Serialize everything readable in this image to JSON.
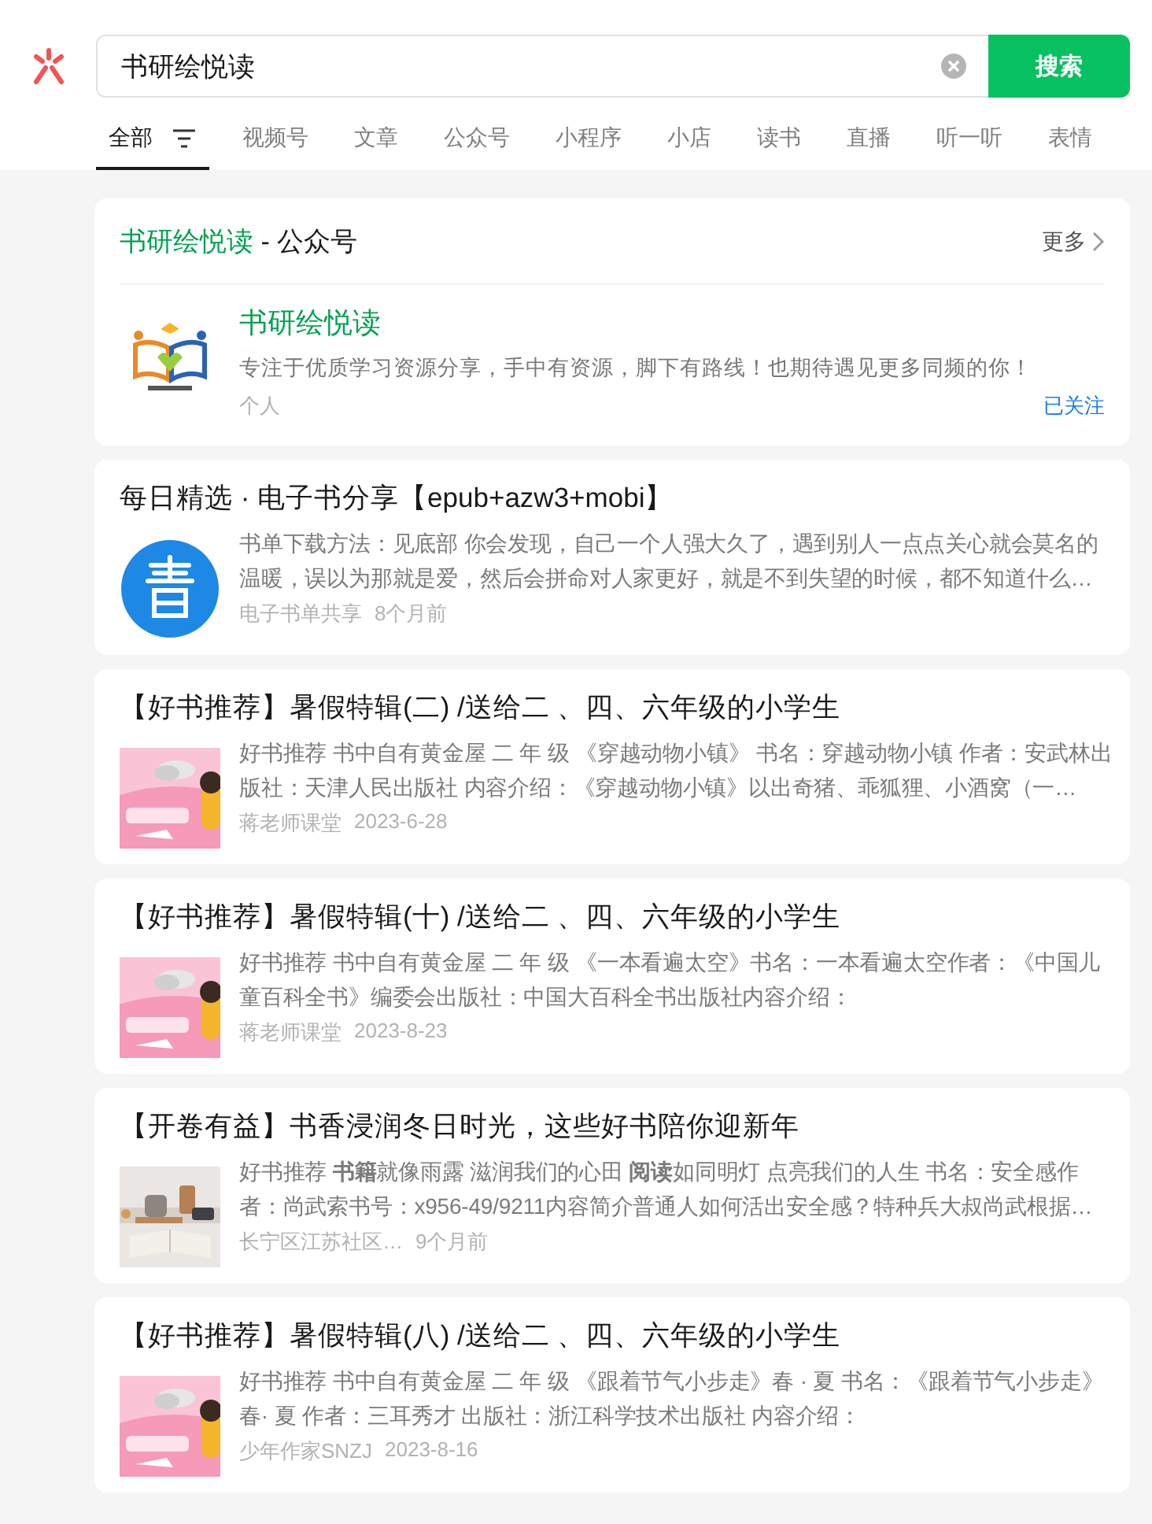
{
  "search": {
    "value": "书研绘悦读",
    "button": "搜索"
  },
  "tabs": [
    {
      "label": "全部",
      "selected": true
    },
    {
      "label": "视频号",
      "selected": false
    },
    {
      "label": "文章",
      "selected": false
    },
    {
      "label": "公众号",
      "selected": false
    },
    {
      "label": "小程序",
      "selected": false
    },
    {
      "label": "小店",
      "selected": false
    },
    {
      "label": "读书",
      "selected": false
    },
    {
      "label": "直播",
      "selected": false
    },
    {
      "label": "听一听",
      "selected": false
    },
    {
      "label": "表情",
      "selected": false
    }
  ],
  "account_card": {
    "title_name": "书研绘悦读",
    "title_suffix": " - 公众号",
    "more": "更多",
    "name": "书研绘悦读",
    "description": "专注于优质学习资源分享，手中有资源，脚下有路线！也期待遇见更多同频的你！",
    "category": "个人",
    "follow_status": "已关注"
  },
  "articles": [
    {
      "title": "每日精选 · 电子书分享【epub+azw3+mobi】",
      "summary": "书单下载方法：见底部 你会发现，自己一个人强大久了，遇到别人一点点关心就会莫名的温暖，误以为那就是爱，然后会拼命对人家更好，就是不到失望的时候，都不知道什么…",
      "source": "电子书单共享",
      "time": "8个月前",
      "kind": "logo"
    },
    {
      "title": "【好书推荐】暑假特辑(二) /送给二 、四、六年级的小学生",
      "summary": "好书推荐 书中自有黄金屋 二 年 级 《穿越动物小镇》 书名：穿越动物小镇 作者：安武林出版社：天津人民出版社 内容介绍：《穿越动物小镇》以出奇猪、乖狐狸、小酒窝（一…",
      "source": "蒋老师课堂",
      "time": "2023-6-28",
      "kind": "pink"
    },
    {
      "title": "【好书推荐】暑假特辑(十) /送给二 、四、六年级的小学生",
      "summary": "好书推荐 书中自有黄金屋 二 年 级 《一本看遍太空》书名：一本看遍太空作者：《中国儿童百科全书》编委会出版社：中国大百科全书出版社内容介绍：",
      "source": "蒋老师课堂",
      "time": "2023-8-23",
      "kind": "pink"
    },
    {
      "title": "【开卷有益】书香浸润冬日时光，这些好书陪你迎新年",
      "summary": "好书推荐 **书籍**就像雨露 滋润我们的心田 **阅读**如同明灯 点亮我们的人生 书名：安全感作者：尚武索书号：x956-49/9211内容简介普通人如何活出安全感？特种兵大叔尚武根据…",
      "source": "长宁区江苏社区…",
      "time": "9个月前",
      "kind": "table"
    },
    {
      "title": "【好书推荐】暑假特辑(八) /送给二 、四、六年级的小学生",
      "summary": "好书推荐 书中自有黄金屋 二 年 级 《跟着节气小步走》春 · 夏 书名：《跟着节气小步走》春· 夏 作者：三耳秀才 出版社：浙江科学技术出版社 内容介绍：",
      "source": "少年作家SNZJ",
      "time": "2023-8-16",
      "kind": "pink"
    }
  ]
}
